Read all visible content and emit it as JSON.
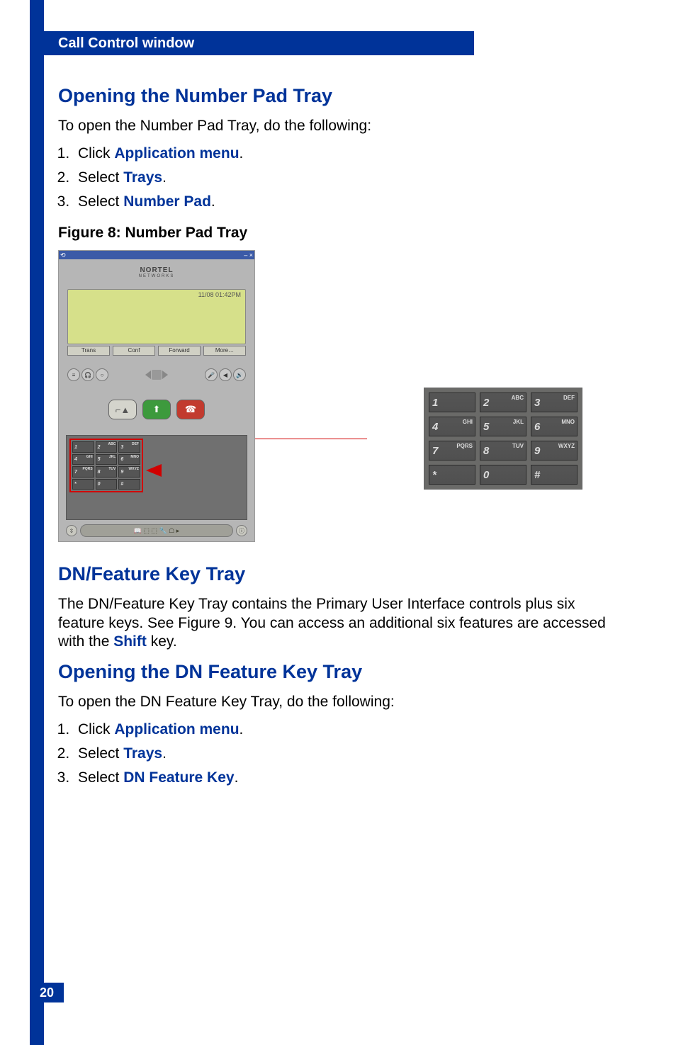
{
  "header": {
    "title": "Call Control window"
  },
  "page_num": "20",
  "section1": {
    "title": "Opening the Number Pad Tray",
    "intro": "To open the Number Pad Tray, do the following:",
    "steps": [
      {
        "pre": "Click ",
        "link": "Application menu",
        "post": "."
      },
      {
        "pre": "Select ",
        "link": "Trays",
        "post": "."
      },
      {
        "pre": "Select ",
        "link": "Number Pad",
        "post": "."
      }
    ],
    "figure_caption": "Figure 8: Number Pad Tray"
  },
  "softphone": {
    "title_left": "⟲",
    "title_right": "– ×",
    "brand": "NORTEL",
    "brand_sub": "NETWORKS",
    "lcd_time": "11/08 01:42PM",
    "softkeys": [
      "Trans",
      "Conf",
      "Forward",
      "More…"
    ],
    "big_buttons": {
      "hold": "⌐▲",
      "answer": "⬆",
      "release": "☎"
    },
    "tray_icons": [
      "⇳",
      "📖 ⬚ ⬚ 🔧 ☖ ▸",
      "ⓘ"
    ]
  },
  "numpad_keys": [
    {
      "digit": "1",
      "letters": ""
    },
    {
      "digit": "2",
      "letters": "ABC"
    },
    {
      "digit": "3",
      "letters": "DEF"
    },
    {
      "digit": "4",
      "letters": "GHI"
    },
    {
      "digit": "5",
      "letters": "JKL"
    },
    {
      "digit": "6",
      "letters": "MNO"
    },
    {
      "digit": "7",
      "letters": "PQRS"
    },
    {
      "digit": "8",
      "letters": "TUV"
    },
    {
      "digit": "9",
      "letters": "WXYZ"
    },
    {
      "digit": "*",
      "letters": ""
    },
    {
      "digit": "0",
      "letters": ""
    },
    {
      "digit": "#",
      "letters": ""
    }
  ],
  "section2": {
    "title": "DN/Feature Key Tray",
    "body_parts": {
      "p1": "The DN/Feature Key Tray contains the Primary User Interface controls plus six feature keys. See Figure 9. You can access an additional six features are accessed with the ",
      "link": "Shift",
      "p2": " key."
    }
  },
  "section3": {
    "title": "Opening the DN Feature Key Tray",
    "intro": "To open the DN Feature Key Tray, do the following:",
    "steps": [
      {
        "pre": "Click ",
        "link": "Application menu",
        "post": "."
      },
      {
        "pre": "Select ",
        "link": "Trays",
        "post": "."
      },
      {
        "pre": "Select ",
        "link": "DN Feature Key",
        "post": "."
      }
    ]
  }
}
